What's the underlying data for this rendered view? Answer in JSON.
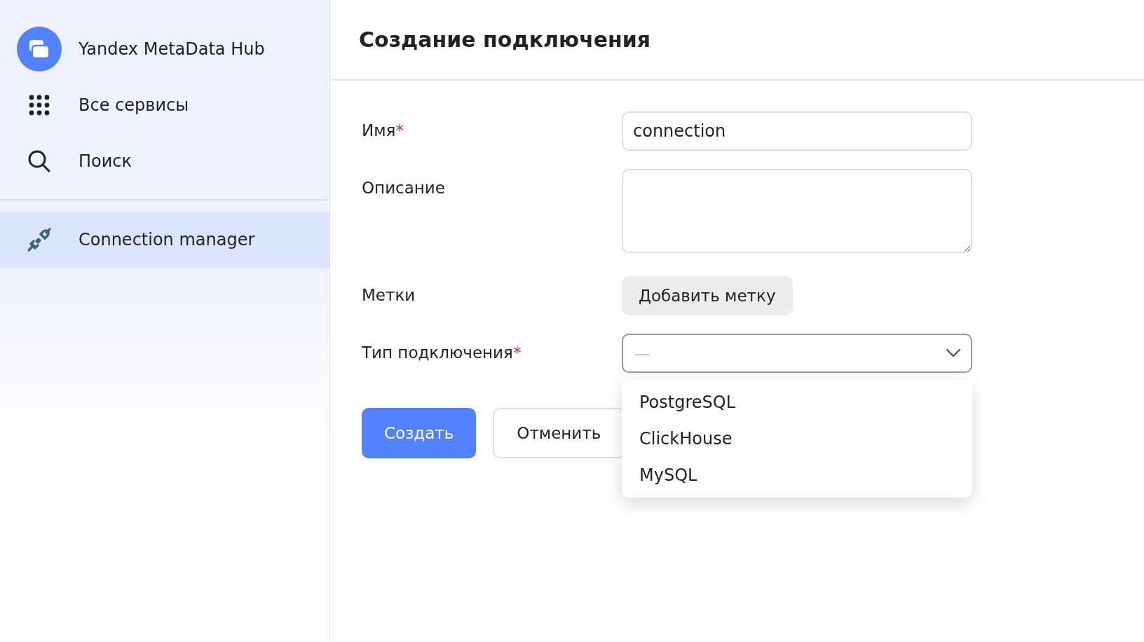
{
  "app": {
    "title": "Yandex MetaData Hub"
  },
  "nav": [
    {
      "kind": "services",
      "label": "Все сервисы",
      "selected": false
    },
    {
      "kind": "search",
      "label": "Поиск",
      "selected": false
    }
  ],
  "sections": [
    {
      "kind": "connections",
      "label": "Connection manager",
      "selected": true
    }
  ],
  "page": {
    "title": "Создание подключения"
  },
  "form": [
    {
      "kind": "text",
      "label": "Имя",
      "required_mark": "*",
      "value": "connection"
    },
    {
      "kind": "textarea",
      "label": "Описание"
    },
    {
      "kind": "tags",
      "label": "Метки",
      "button": "Добавить метку"
    },
    {
      "kind": "select",
      "label": "Тип подключения",
      "required_mark": "*",
      "placeholder": "—",
      "expanded": true,
      "options": [
        "PostgreSQL",
        "ClickHouse",
        "MySQL"
      ]
    }
  ],
  "buttons": [
    {
      "kind": "primary",
      "label": "Создать"
    },
    {
      "kind": "secondary",
      "label": "Отменить"
    }
  ]
}
